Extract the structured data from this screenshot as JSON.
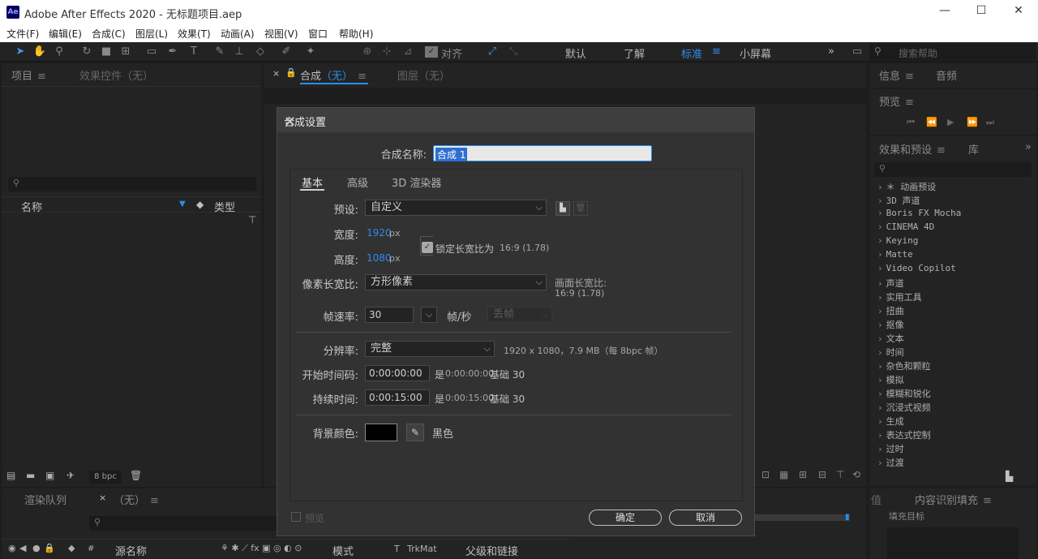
{
  "window": {
    "logo": "Ae",
    "title": "Adobe After Effects 2020 - 无标题项目.aep",
    "minimize": "—",
    "maximize": "☐",
    "close": "✕"
  },
  "menu": [
    "文件(F)",
    "编辑(E)",
    "合成(C)",
    "图层(L)",
    "效果(T)",
    "动画(A)",
    "视图(V)",
    "窗口",
    "帮助(H)"
  ],
  "toolbar": {
    "align_label": "对齐",
    "workspaces": [
      "默认",
      "了解",
      "标准",
      "小屏幕"
    ],
    "workspace_menu": "≡",
    "more": "»",
    "search_placeholder": "搜索帮助"
  },
  "project_panel": {
    "tab_project": "项目",
    "tab_effects_controls": "效果控件（无）",
    "col_name": "名称",
    "col_type": "类型",
    "bpc": "8 bpc"
  },
  "comp_panel": {
    "tab_comp_prefix": "合成",
    "tab_comp_name": "（无）",
    "tab_layer": "图层（无）"
  },
  "right_panels": {
    "tab_info": "信息",
    "tab_audio": "音频",
    "tab_preview": "预览",
    "tab_effects": "效果和预设",
    "tab_library": "库",
    "effects_list": [
      "＊ 动画预设",
      "3D 声道",
      "Boris FX Mocha",
      "CINEMA 4D",
      "Keying",
      "Matte",
      "Video Copilot",
      "声道",
      "实用工具",
      "扭曲",
      "抠像",
      "文本",
      "时间",
      "杂色和颗粒",
      "模拟",
      "模糊和锐化",
      "沉浸式视频",
      "生成",
      "表达式控制",
      "过时",
      "过渡"
    ],
    "tab_content_fill": "内容识别填充",
    "fill_target": "填充目标"
  },
  "bottom_panel": {
    "tab_render_queue": "渲染队列",
    "tab_timeline": "（无）",
    "col_source_name": "源名称",
    "col_mode": "模式",
    "col_t": "T",
    "col_trkmat": "TrkMat",
    "col_parent": "父级和链接",
    "col_hash": "#"
  },
  "dialog": {
    "title": "合成设置",
    "comp_name_label": "合成名称:",
    "comp_name_value": "合成 1",
    "tabs": [
      "基本",
      "高级",
      "3D 渲染器"
    ],
    "preset_label": "预设:",
    "preset_value": "自定义",
    "width_label": "宽度:",
    "width_value": "1920",
    "height_label": "高度:",
    "height_value": "1080",
    "px": "px",
    "lock_aspect_label": "锁定长宽比为",
    "lock_aspect_value": "16:9 (1.78)",
    "pixel_aspect_label": "像素长宽比:",
    "pixel_aspect_value": "方形像素",
    "frame_aspect_label": "画面长宽比:",
    "frame_aspect_value": "16:9 (1.78)",
    "fps_label": "帧速率:",
    "fps_value": "30",
    "fps_unit": "帧/秒",
    "drop_frame": "丢帧",
    "resolution_label": "分辨率:",
    "resolution_value": "完整",
    "resolution_info": "1920 x 1080，7.9 MB（每 8bpc 帧）",
    "start_tc_label": "开始时间码:",
    "start_tc_value": "0:00:00:00",
    "start_tc_info_prefix": "是",
    "start_tc_info": "0:00:00:00",
    "start_tc_base": "基础 30",
    "duration_label": "持续时间:",
    "duration_value": "0:00:15:00",
    "duration_info_prefix": "是",
    "duration_info": "0:00:15:00",
    "duration_base": "基础 30",
    "bg_color_label": "背景颜色:",
    "bg_color_name": "黑色",
    "bg_color_hex": "#000000",
    "preview_label": "预览",
    "ok_label": "确定",
    "cancel_label": "取消"
  },
  "colors": {
    "accent_blue": "#2d8ceb",
    "panel_bg": "#232323",
    "dialog_bg": "#323232"
  }
}
